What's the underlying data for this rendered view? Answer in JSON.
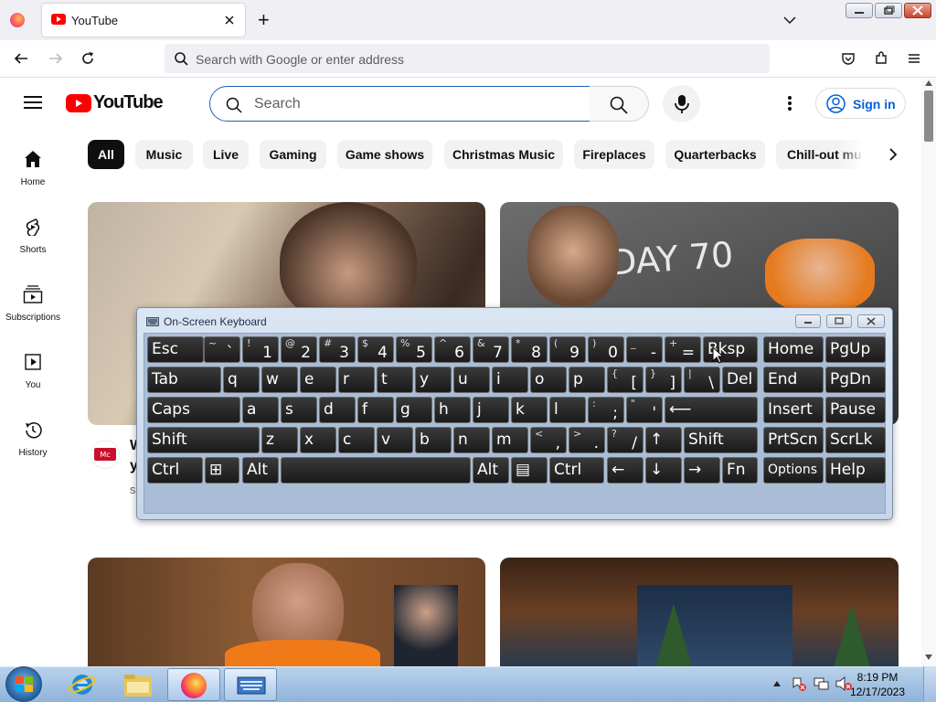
{
  "browser": {
    "tab_title": "YouTube",
    "new_tab_symbol": "+",
    "address_placeholder": "Search with Google or enter address"
  },
  "youtube": {
    "logo_text": "YouTube",
    "search_placeholder": "Search",
    "sign_in_label": "Sign in",
    "chips": [
      "All",
      "Music",
      "Live",
      "Gaming",
      "Game shows",
      "Christmas Music",
      "Fireplaces",
      "Quarterbacks",
      "Chill-out mu"
    ],
    "sidebar": [
      {
        "label": "Home",
        "icon": "home-icon"
      },
      {
        "label": "Shorts",
        "icon": "shorts-icon"
      },
      {
        "label": "Subscriptions",
        "icon": "subscriptions-icon"
      },
      {
        "label": "You",
        "icon": "you-icon"
      },
      {
        "label": "History",
        "icon": "history-icon"
      }
    ],
    "partial_title_chars": [
      "W",
      "y",
      "s"
    ],
    "thumb_text": "DAY 70"
  },
  "osk": {
    "title": "On-Screen Keyboard",
    "rows": [
      [
        {
          "label": "Esc"
        },
        {
          "shift": "~",
          "main": "`"
        },
        {
          "shift": "!",
          "main": "1"
        },
        {
          "shift": "@",
          "main": "2"
        },
        {
          "shift": "#",
          "main": "3"
        },
        {
          "shift": "$",
          "main": "4"
        },
        {
          "shift": "%",
          "main": "5"
        },
        {
          "shift": "^",
          "main": "6"
        },
        {
          "shift": "&",
          "main": "7"
        },
        {
          "shift": "*",
          "main": "8"
        },
        {
          "shift": "(",
          "main": "9"
        },
        {
          "shift": ")",
          "main": "0"
        },
        {
          "shift": "_",
          "main": "-"
        },
        {
          "shift": "+",
          "main": "="
        },
        {
          "label": "Bksp"
        },
        {
          "label": "Home"
        },
        {
          "label": "PgUp"
        }
      ],
      [
        {
          "label": "Tab"
        },
        {
          "label": "q"
        },
        {
          "label": "w"
        },
        {
          "label": "e"
        },
        {
          "label": "r"
        },
        {
          "label": "t"
        },
        {
          "label": "y"
        },
        {
          "label": "u"
        },
        {
          "label": "i"
        },
        {
          "label": "o"
        },
        {
          "label": "p"
        },
        {
          "shift": "{",
          "main": "["
        },
        {
          "shift": "}",
          "main": "]"
        },
        {
          "shift": "|",
          "main": "\\"
        },
        {
          "label": "Del"
        },
        {
          "label": "End"
        },
        {
          "label": "PgDn"
        }
      ],
      [
        {
          "label": "Caps"
        },
        {
          "label": "a"
        },
        {
          "label": "s"
        },
        {
          "label": "d"
        },
        {
          "label": "f"
        },
        {
          "label": "g"
        },
        {
          "label": "h"
        },
        {
          "label": "j"
        },
        {
          "label": "k"
        },
        {
          "label": "l"
        },
        {
          "shift": ":",
          "main": ";"
        },
        {
          "shift": "\"",
          "main": "'"
        },
        {
          "label": "⟵"
        },
        {
          "label": "Insert"
        },
        {
          "label": "Pause"
        }
      ],
      [
        {
          "label": "Shift"
        },
        {
          "label": "z"
        },
        {
          "label": "x"
        },
        {
          "label": "c"
        },
        {
          "label": "v"
        },
        {
          "label": "b"
        },
        {
          "label": "n"
        },
        {
          "label": "m"
        },
        {
          "shift": "<",
          "main": ","
        },
        {
          "shift": ">",
          "main": "."
        },
        {
          "shift": "?",
          "main": "/"
        },
        {
          "label": "↑"
        },
        {
          "label": "Shift"
        },
        {
          "label": "PrtScn"
        },
        {
          "label": "ScrLk"
        }
      ],
      [
        {
          "label": "Ctrl"
        },
        {
          "label": "⊞"
        },
        {
          "label": "Alt"
        },
        {
          "label": ""
        },
        {
          "label": "Alt"
        },
        {
          "label": "▤"
        },
        {
          "label": "Ctrl"
        },
        {
          "label": "←"
        },
        {
          "label": "↓"
        },
        {
          "label": "→"
        },
        {
          "label": "Fn"
        },
        {
          "label": "Options"
        },
        {
          "label": "Help"
        }
      ]
    ]
  },
  "taskbar": {
    "time": "8:19 PM",
    "date": "12/17/2023"
  }
}
